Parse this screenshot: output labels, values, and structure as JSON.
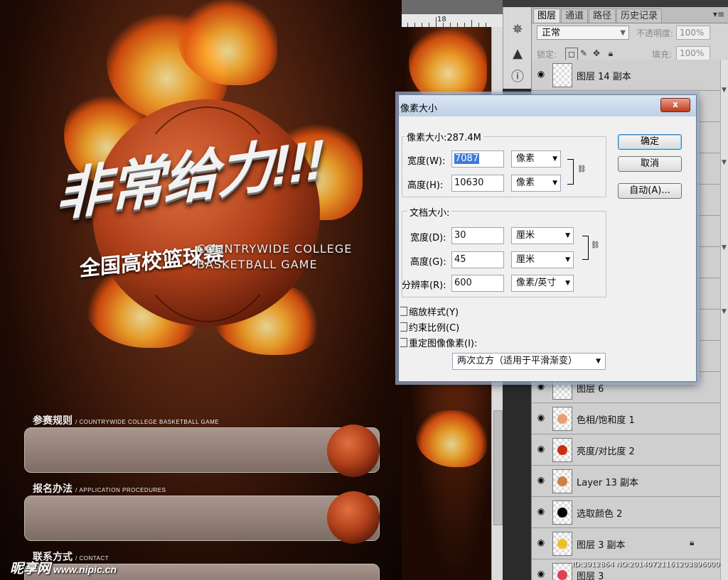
{
  "poster": {
    "title": "非常给力!!!",
    "subtitle_cn": "全国高校篮球赛",
    "subtitle_en_line1": "COUNTRYWIDE COLLEGE",
    "subtitle_en_line2": "BASKETBALL GAME",
    "sections": [
      {
        "cn": "参赛规则",
        "en": "/ COUNTRYWIDE COLLEGE BASKETBALL GAME"
      },
      {
        "cn": "报名办法",
        "en": "/ APPLICATION PROCEDURES"
      },
      {
        "cn": "联系方式",
        "en": "/ CONTACT"
      }
    ],
    "watermark_brand": "昵享网",
    "watermark_url": "www.nipic.cn"
  },
  "ruler": {
    "number": "18"
  },
  "panel": {
    "tabs": [
      "图层",
      "通道",
      "路径",
      "历史记录"
    ],
    "active_tab": "图层",
    "blend_mode": "正常",
    "opacity_label": "不透明度:",
    "opacity_value": "100%",
    "lock_label": "锁定:",
    "fill_label": "填充:",
    "fill_value": "100%",
    "layers": [
      {
        "name": "图层 14 副本",
        "thumb_color": ""
      },
      {
        "name": "图层 6",
        "thumb_color": ""
      },
      {
        "name": "色相/饱和度 1",
        "thumb_color": "#e8a070"
      },
      {
        "name": "亮度/对比度 2",
        "thumb_color": "#c83010"
      },
      {
        "name": "Layer 13 副本",
        "thumb_color": "#d08040"
      },
      {
        "name": "选取颜色 2",
        "thumb_color": "#000000"
      },
      {
        "name": "图层 3 副本",
        "thumb_color": "#f0c020"
      },
      {
        "name": "图层 3",
        "thumb_color": "#e04050"
      }
    ]
  },
  "status": "ID:3912864 NO:20140721161203896000",
  "dialog": {
    "title": "像素大小",
    "pixel_size_label": "像素大小:287.4M",
    "width_label": "宽度(W):",
    "width_value": "7087",
    "width_unit": "像素",
    "height_label": "高度(H):",
    "height_value": "10630",
    "height_unit": "像素",
    "doc_size_label": "文档大小:",
    "doc_width_label": "宽度(D):",
    "doc_width_value": "30",
    "doc_width_unit": "厘米",
    "doc_height_label": "高度(G):",
    "doc_height_value": "45",
    "doc_height_unit": "厘米",
    "resolution_label": "分辨率(R):",
    "resolution_value": "600",
    "resolution_unit": "像素/英寸",
    "ok": "确定",
    "cancel": "取消",
    "auto": "自动(A)...",
    "scale_styles": "缩放样式(Y)",
    "constrain": "约束比例(C)",
    "resample": "重定图像像素(I):",
    "resample_method": "两次立方（适用于平滑渐变）",
    "close": "x"
  }
}
